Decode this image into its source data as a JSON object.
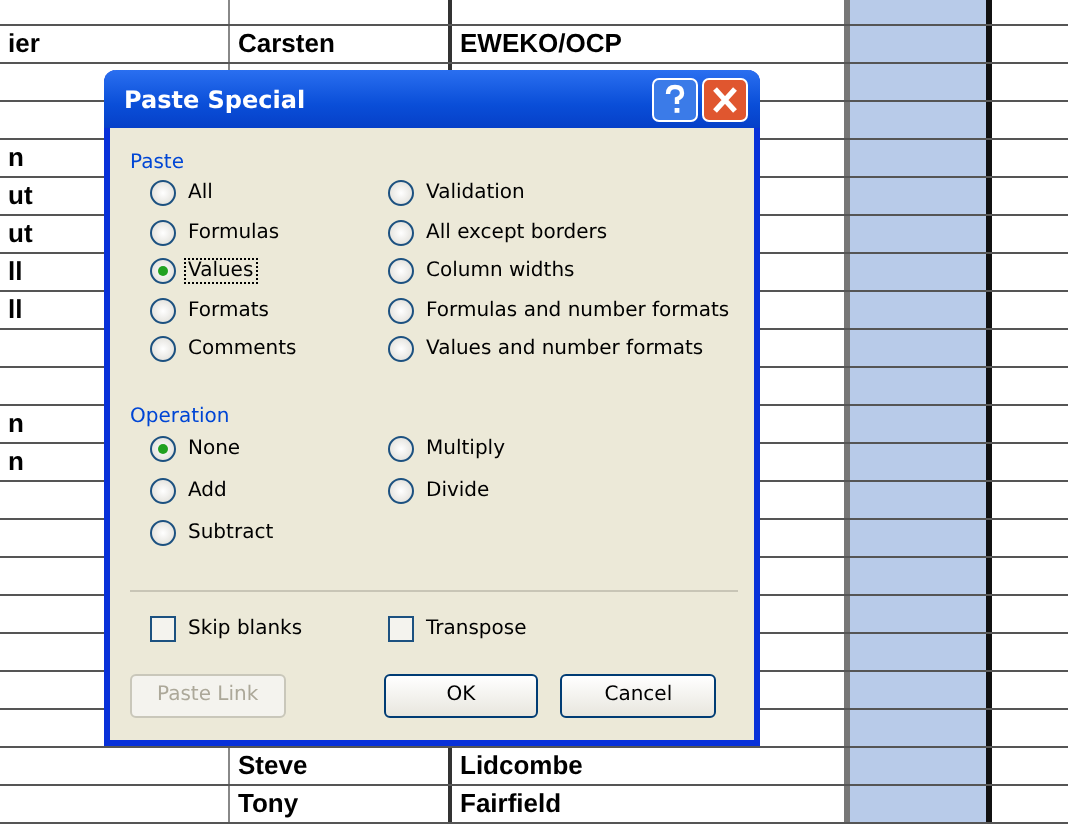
{
  "sheet": {
    "rows": [
      {},
      {
        "column_1": "ier",
        "column_2": "Carsten",
        "column_3": "EWEKO/OCP"
      },
      {},
      {},
      {
        "column_1": "n"
      },
      {
        "column_1": "ut"
      },
      {
        "column_1": "ut"
      },
      {
        "column_1": "ll"
      },
      {
        "column_1": "ll"
      },
      {},
      {},
      {
        "column_1": "n"
      },
      {
        "column_1": "n"
      },
      {},
      {},
      {},
      {},
      {},
      {},
      {},
      {
        "column_2": "Steve",
        "column_3": "Lidcombe"
      },
      {
        "column_2": "Tony",
        "column_3": "Fairfield"
      }
    ]
  },
  "dialog": {
    "title": "Paste Special",
    "paste": {
      "label": "Paste",
      "options": [
        {
          "label": "All",
          "selected": false,
          "focused": false
        },
        {
          "label": "Formulas",
          "selected": false,
          "focused": false
        },
        {
          "label": "Values",
          "selected": true,
          "focused": true
        },
        {
          "label": "Formats",
          "selected": false,
          "focused": false
        },
        {
          "label": "Comments",
          "selected": false,
          "focused": false
        },
        {
          "label": "Validation",
          "selected": false,
          "focused": false
        },
        {
          "label": "All except borders",
          "selected": false,
          "focused": false
        },
        {
          "label": "Column widths",
          "selected": false,
          "focused": false
        },
        {
          "label": "Formulas and number formats",
          "selected": false,
          "focused": false
        },
        {
          "label": "Values and number formats",
          "selected": false,
          "focused": false
        }
      ]
    },
    "operation": {
      "label": "Operation",
      "options": [
        {
          "label": "None",
          "selected": true
        },
        {
          "label": "Add",
          "selected": false
        },
        {
          "label": "Subtract",
          "selected": false
        },
        {
          "label": "Multiply",
          "selected": false
        },
        {
          "label": "Divide",
          "selected": false
        }
      ]
    },
    "checkboxes": [
      {
        "label": "Skip blanks",
        "checked": false
      },
      {
        "label": "Transpose",
        "checked": false
      }
    ],
    "buttons": [
      {
        "label": "Paste Link",
        "disabled": true
      },
      {
        "label": "OK",
        "disabled": false
      },
      {
        "label": "Cancel",
        "disabled": false
      }
    ]
  }
}
